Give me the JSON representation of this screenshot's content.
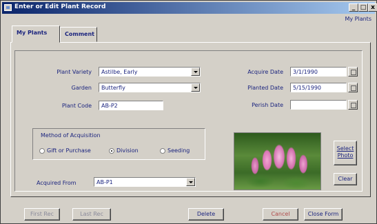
{
  "window": {
    "title": "Enter or Edit Plant Record",
    "controls": [
      "_",
      "□",
      "x"
    ],
    "header_right": "My Plants"
  },
  "tabs": [
    {
      "label": "My Plants",
      "active": true
    },
    {
      "label": "Comment",
      "active": false
    }
  ],
  "form": {
    "plant_variety": {
      "label": "Plant Variety",
      "value": "Astilbe, Early"
    },
    "garden": {
      "label": "Garden",
      "value": "Butterfly"
    },
    "plant_code": {
      "label": "Plant Code",
      "value": "AB-P2"
    },
    "acquire_date": {
      "label": "Acquire Date",
      "value": "3/1/1990"
    },
    "planted_date": {
      "label": "Planted Date",
      "value": "5/15/1990"
    },
    "perish_date": {
      "label": "Perish Date",
      "value": ""
    },
    "method": {
      "label": "Method of Acquisition",
      "options": [
        {
          "label": "Gift or Purchase",
          "selected": false
        },
        {
          "label": "Division",
          "selected": true
        },
        {
          "label": "Seeding",
          "selected": false
        }
      ]
    },
    "acquired_from": {
      "label": "Acquired From",
      "value": "AB-P1"
    }
  },
  "photo_buttons": {
    "select": "Select Photo",
    "clear": "Clear"
  },
  "bottom_buttons": {
    "first": "First Rec",
    "last": "Last Rec",
    "delete": "Delete",
    "cancel": "Cancel",
    "close": "Close Form"
  }
}
